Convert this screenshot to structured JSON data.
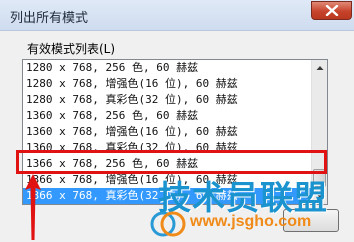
{
  "window": {
    "title": "列出所有模式",
    "close_icon": "close-icon"
  },
  "dialog": {
    "list_label": "有效模式列表(L)",
    "modes": [
      "1280 x 768, 256 色, 60 赫兹",
      "1280 x 768, 增强色(16 位), 60 赫兹",
      "1280 x 768, 真彩色(32 位), 60 赫兹",
      "1360 x 768, 256 色, 60 赫兹",
      "1360 x 768, 增强色(16 位), 60 赫兹",
      "1360 x 768, 真彩色(32 位), 60 赫兹",
      "1366 x 768, 256 色, 60 赫兹",
      "1366 x 768, 增强色(16 位), 60 赫兹",
      "1366 x 768, 真彩色(32 位), 60 赫兹"
    ],
    "selected_mode": "1366 x 768, 真彩色(32 位), 60 赫兹"
  },
  "annotation": {
    "highlight_color": "#e01212",
    "arrow_icon": "red-arrow-up-icon"
  },
  "watermark": {
    "title": "技术员联盟",
    "url": "www.jsgho.com"
  },
  "colors": {
    "selection": "#3399ff",
    "watermark_blue": "#1b93cf",
    "watermark_orange": "#f08a18"
  }
}
